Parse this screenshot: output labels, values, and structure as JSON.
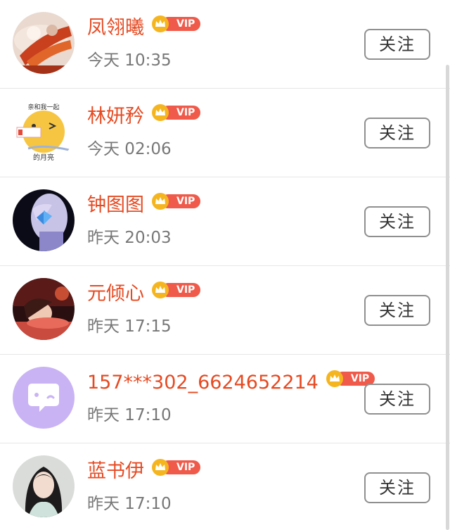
{
  "follow_label": "关注",
  "vip_label": "VIP",
  "users": [
    {
      "name": "凤翎曦",
      "time": "今天 10:35",
      "avatar": "food-photo"
    },
    {
      "name": "林妍矜",
      "time": "今天 02:06",
      "avatar": "moon-cartoon",
      "avatar_caption_top": "亲和我一起",
      "avatar_caption_bottom": "的月亮"
    },
    {
      "name": "钟图图",
      "time": "昨天 20:03",
      "avatar": "butterfly-portrait"
    },
    {
      "name": "元倾心",
      "time": "昨天 17:15",
      "avatar": "sleeping-girl"
    },
    {
      "name": "157***302_6624652214",
      "time": "昨天 17:10",
      "avatar": "default-chat-bubble"
    },
    {
      "name": "蓝书伊",
      "time": "昨天 17:10",
      "avatar": "girl-portrait"
    }
  ],
  "colors": {
    "name": "#e64a22",
    "vip_badge": "#ef5a4a",
    "crown": "#f5b51f",
    "default_avatar": "#c9b3f5"
  }
}
